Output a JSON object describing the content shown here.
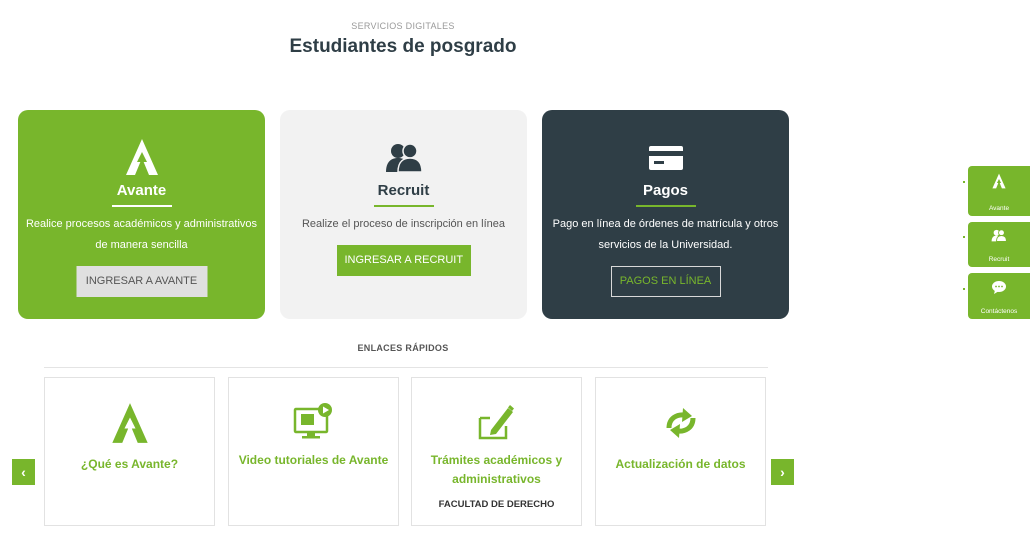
{
  "header": {
    "eyebrow": "SERVICIOS DIGITALES",
    "title": "Estudiantes de posgrado"
  },
  "cards": {
    "avante": {
      "icon": "avante-logo-icon",
      "title": "Avante",
      "description": "Realice procesos académicos y administrativos de manera sencilla",
      "button": "INGRESAR A AVANTE"
    },
    "recruit": {
      "icon": "people-icon",
      "title": "Recruit",
      "description": "Realize el proceso de inscripción en línea",
      "button": "INGRESAR A RECRUIT"
    },
    "pagos": {
      "icon": "credit-card-icon",
      "title": "Pagos",
      "description": "Pago en línea de órdenes de matrícula y otros servicios de la Universidad.",
      "button": "PAGOS EN LÍNEA"
    }
  },
  "quick_links": {
    "label": "ENLACES RÁPIDOS",
    "items": [
      {
        "icon": "avante-logo-icon",
        "label": "¿Qué es Avante?",
        "sublabel": ""
      },
      {
        "icon": "video-screen-icon",
        "label": "Video tutoriales de Avante",
        "sublabel": ""
      },
      {
        "icon": "edit-document-icon",
        "label": "Trámites académicos y administrativos",
        "sublabel": "FACULTAD DE DERECHO"
      },
      {
        "icon": "refresh-arrows-icon",
        "label": "Actualización de datos",
        "sublabel": ""
      }
    ],
    "prev": "‹",
    "next": "›"
  },
  "side_buttons": {
    "avante": "Avante",
    "recruit": "Recruit",
    "contact": "Contáctenos"
  },
  "colors": {
    "brand_green": "#78b62c",
    "dark_slate": "#2f3e46",
    "light_gray": "#f2f2f2"
  }
}
